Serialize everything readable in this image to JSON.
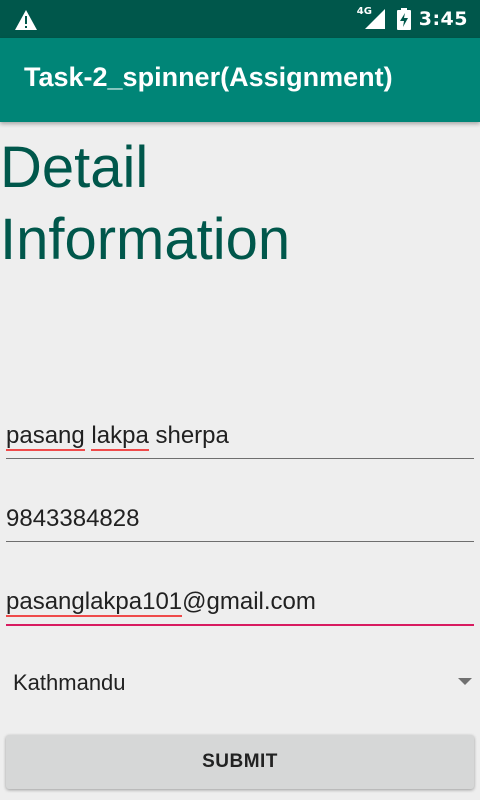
{
  "status_bar": {
    "network_type": "4G",
    "time": "3:45",
    "warning_icon": "warning-icon",
    "signal_icon": "signal-icon",
    "battery_icon": "battery-charging-icon"
  },
  "app_bar": {
    "title": "Task-2_spinner(Assignment)",
    "color": "#008577"
  },
  "heading": "Detail Information",
  "form": {
    "name": {
      "words": [
        "pasang",
        "lakpa",
        "sherpa"
      ]
    },
    "phone": {
      "value": "9843384828"
    },
    "email": {
      "user_part": "pasanglakpa101",
      "domain_part": "@gmail.com"
    },
    "city_spinner": {
      "selected": "Kathmandu"
    },
    "submit_label": "SUBMIT"
  },
  "colors": {
    "status_bar": "#00574b",
    "primary": "#008577",
    "heading": "#00574b",
    "accent": "#d81b60",
    "spellcheck": "#ef4a4a"
  }
}
